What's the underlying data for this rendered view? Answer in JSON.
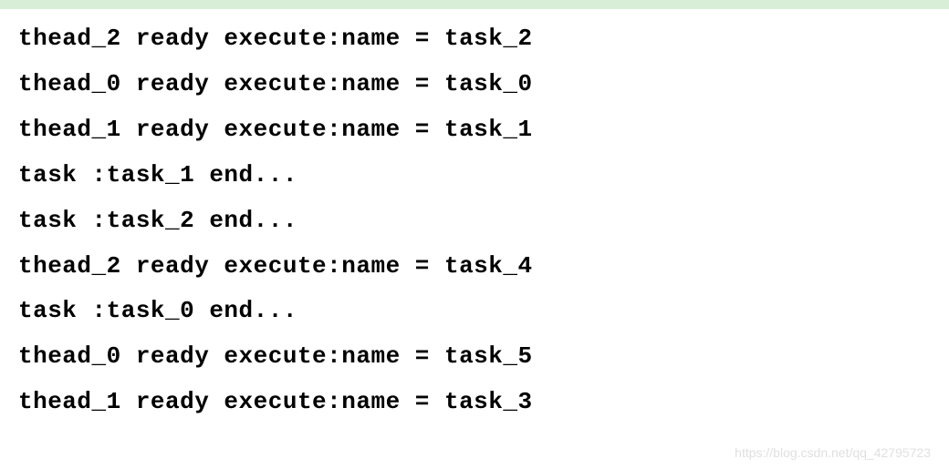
{
  "console": {
    "lines": [
      "thead_2 ready execute:name = task_2",
      "thead_0 ready execute:name = task_0",
      "thead_1 ready execute:name = task_1",
      "task :task_1 end...",
      "task :task_2 end...",
      "thead_2 ready execute:name = task_4",
      "task :task_0 end...",
      "thead_0 ready execute:name = task_5",
      "thead_1 ready execute:name = task_3"
    ]
  },
  "watermark": "https://blog.csdn.net/qq_42795723"
}
